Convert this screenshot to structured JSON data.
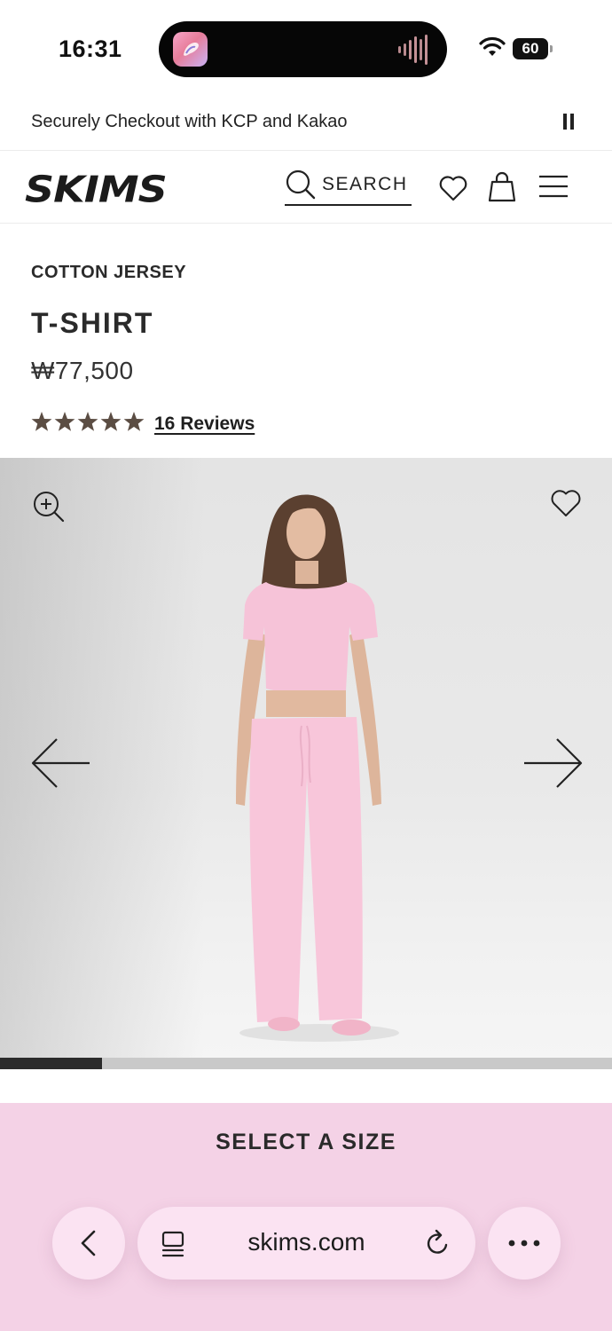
{
  "status_bar": {
    "time": "16:31",
    "battery_level": "60",
    "icons": [
      "app-icon",
      "audio-waveform-icon",
      "wifi-icon",
      "battery-icon"
    ]
  },
  "announcement": {
    "text": "Securely Checkout with KCP and Kakao",
    "control_icon": "pause-icon"
  },
  "header": {
    "logo_text": "SKIMS",
    "search_label": "SEARCH",
    "icons": [
      "search-icon",
      "heart-icon",
      "bag-icon",
      "menu-icon"
    ]
  },
  "product": {
    "collection": "COTTON JERSEY",
    "title": "T-SHIRT",
    "price": "₩77,500",
    "rating": 5,
    "rating_max": 5,
    "reviews_label": "16 Reviews"
  },
  "gallery": {
    "image_description": "model wearing pink t-shirt and pink pants",
    "progress_fraction": 0.166,
    "icons": [
      "zoom-in-icon",
      "heart-icon",
      "arrow-left-icon",
      "arrow-right-icon"
    ]
  },
  "size_selector": {
    "label": "SELECT A SIZE"
  },
  "browser": {
    "url": "skims.com",
    "icons": [
      "chevron-left-icon",
      "tabs-icon",
      "reload-icon",
      "more-icon"
    ]
  },
  "colors": {
    "accent_pink": "#f4d2e6",
    "toolbar_pink": "#fbe3f2",
    "star_color": "#5b4d43",
    "text_dark": "#222222"
  }
}
